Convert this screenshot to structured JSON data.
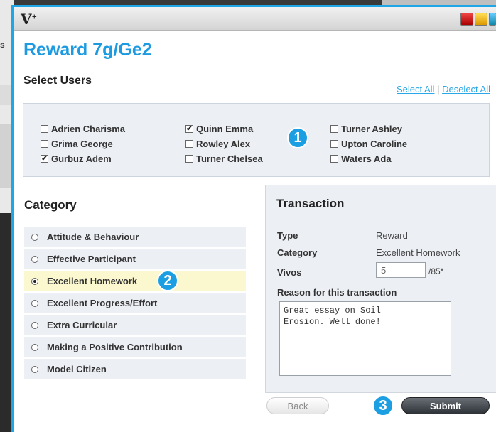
{
  "background": {
    "fragment_text": "s"
  },
  "window": {
    "logo": "V",
    "logo_mark": "+",
    "title": "Reward 7g/Ge2"
  },
  "select_users": {
    "heading": "Select Users",
    "select_all": "Select All",
    "separator": "|",
    "deselect_all": "Deselect All",
    "users": [
      {
        "name": "Adrien Charisma",
        "checked": false
      },
      {
        "name": "Grima George",
        "checked": false
      },
      {
        "name": "Gurbuz Adem",
        "checked": true
      },
      {
        "name": "Quinn Emma",
        "checked": true
      },
      {
        "name": "Rowley Alex",
        "checked": false
      },
      {
        "name": "Turner Chelsea",
        "checked": false
      },
      {
        "name": "Turner Ashley",
        "checked": false
      },
      {
        "name": "Upton Caroline",
        "checked": false
      },
      {
        "name": "Waters Ada",
        "checked": false
      }
    ]
  },
  "badges": {
    "one": "1",
    "two": "2",
    "three": "3"
  },
  "category": {
    "heading": "Category",
    "items": [
      {
        "label": "Attitude & Behaviour",
        "selected": false
      },
      {
        "label": "Effective Participant",
        "selected": false
      },
      {
        "label": "Excellent Homework",
        "selected": true
      },
      {
        "label": "Excellent Progress/Effort",
        "selected": false
      },
      {
        "label": "Extra Curricular",
        "selected": false
      },
      {
        "label": "Making a Positive Contribution",
        "selected": false
      },
      {
        "label": "Model Citizen",
        "selected": false
      }
    ]
  },
  "transaction": {
    "heading": "Transaction",
    "type_label": "Type",
    "type_value": "Reward",
    "category_label": "Category",
    "category_value": "Excellent Homework",
    "vivos_label": "Vivos",
    "vivos_value": "5",
    "vivos_max": "/85*",
    "reason_label": "Reason for this transaction",
    "reason_value": "Great essay on Soil\nErosion. Well done!"
  },
  "buttons": {
    "back": "Back",
    "submit": "Submit"
  },
  "colors": {
    "accent": "#1e9be0",
    "panel": "#eceff4",
    "selected_row": "#fbf8cf"
  }
}
